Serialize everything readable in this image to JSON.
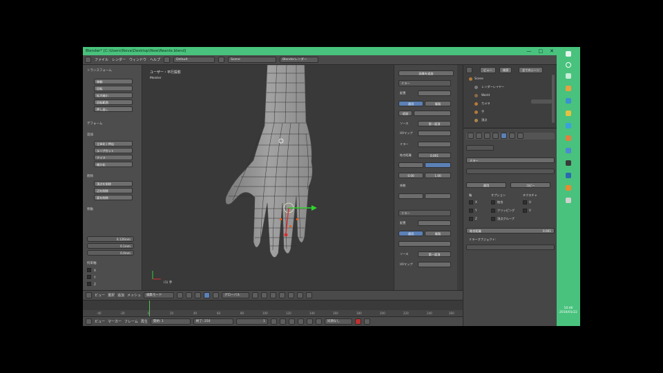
{
  "window": {
    "title": "Blender* [C:\\Users\\Nova\\Desktop\\New\\Reanle.blend]"
  },
  "menubar": {
    "items": [
      "ファイル",
      "レンダー",
      "ウィンドウ",
      "ヘルプ"
    ],
    "layout": "Default",
    "scene": "Scene",
    "engine": "Blenderレンダー"
  },
  "tool_shelf": {
    "header": "トランスフォーム",
    "transform_buttons": [
      "移動",
      "回転",
      "拡大縮小",
      "回転範囲",
      "押し出し"
    ],
    "deform_label": "デフォーム",
    "add_label": "追加",
    "add_buttons": [
      "立体化 | 押出",
      "ループカット",
      "ナイフ",
      "細分化"
    ],
    "remove_label": "削除",
    "remove_buttons": [
      "頂点を削除",
      "辺を削除",
      "面を削除"
    ],
    "last_op_label": "移動",
    "vector_values": [
      "0.126mm",
      "0.1mm",
      "0.0mm"
    ],
    "constraint_label": "拘束軸",
    "constraint_items": [
      "X",
      "Y",
      "Z"
    ],
    "orientation_label": "座標系"
  },
  "viewport": {
    "title": "ユーザー・平行投影",
    "object": "Meister",
    "axis_label": "(1) 手"
  },
  "n_panel": {
    "top_button": "画像を追加",
    "modifier1": {
      "name": "ミラー",
      "type_label": "配置",
      "apply": "適用",
      "copy": "複製",
      "add_uv": "追加",
      "source_label": "ソース",
      "source_value": "第一面頂",
      "uv_label": "UVマップ",
      "mirror_label": "ミラー",
      "merge_label": "結合距離",
      "merge_value": "0.001",
      "factor_label": "係数",
      "x_value": "0.00",
      "y_value": "1.00"
    },
    "modifier2": {
      "name": "ミラー",
      "type_label": "配置",
      "apply": "適用",
      "copy": "複製",
      "source_label": "ソース",
      "source_value": "第一面頂",
      "uv_label": "UVマップ"
    }
  },
  "outliner": {
    "tabs": [
      "ビュー",
      "検索",
      "全てのシーン"
    ],
    "items": [
      "Scene",
      "レンダーレイヤー",
      "World",
      "カメラ",
      "手",
      "頂点"
    ]
  },
  "properties": {
    "header": "ミラー",
    "apply": "適用",
    "copy": "コピー",
    "axis_label": "軸",
    "options_label": "オプション",
    "texture_label": "テクスチャ",
    "axes": [
      "X",
      "Y",
      "Z"
    ],
    "options": [
      "結合",
      "クリッピング",
      "頂点グループ"
    ],
    "textures": [
      "U",
      "V"
    ],
    "merge_label": "結合距離",
    "merge_value": "0.001",
    "mirror_object_label": "ミラーオブジェクト:"
  },
  "header_3d": {
    "view": "ビュー",
    "select": "選択",
    "add": "追加",
    "mesh": "メッシュ",
    "mode": "編集モード",
    "pivot": "グローバル"
  },
  "timeline": {
    "ticks": [
      "-40",
      "-20",
      "0",
      "20",
      "40",
      "60",
      "80",
      "100",
      "120",
      "140",
      "160",
      "180",
      "200",
      "220",
      "240",
      "260"
    ],
    "view": "ビュー",
    "marker": "マーカー",
    "frame": "フレーム",
    "playback": "再生",
    "start_label": "開始:",
    "start_value": "1",
    "end_label": "終了:",
    "end_value": "250",
    "current": "1",
    "sync": "同期なし"
  },
  "taskbar": {
    "time": "10:46",
    "date": "2016/01/22"
  },
  "colors": {
    "accent_green": "#49c27d",
    "blender_blue": "#5b80b6",
    "panel_gray": "#464646"
  }
}
